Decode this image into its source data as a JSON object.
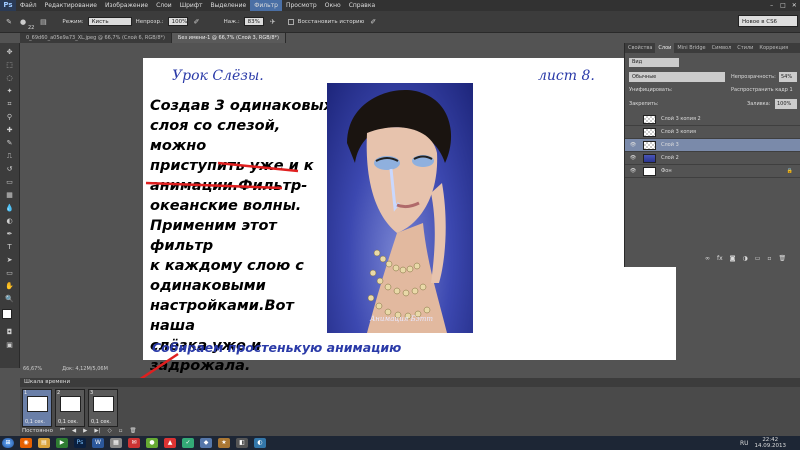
{
  "app": {
    "logo": "Ps"
  },
  "menu": [
    "Файл",
    "Редактирование",
    "Изображение",
    "Слои",
    "Шрифт",
    "Выделение",
    "Фильтр",
    "Просмотр",
    "Окно",
    "Справка"
  ],
  "options": {
    "brush_size": "22",
    "mode_label": "Режим:",
    "mode_value": "Кисть",
    "opacity_label": "Непрозр.:",
    "opacity_value": "100%",
    "flow_label": "Наж.:",
    "flow_value": "83%",
    "history_label": "Восстановить историю"
  },
  "workspace": "Новое в CS6",
  "doc_tabs": [
    "0_69d60_a05e9a73_XL.jpeg @ 66,7% (Слой 6, RGB/8*)",
    "Без имени-1 @ 66,7% (Слой 3, RGB/8*)"
  ],
  "canvas": {
    "title": "Урок Слёзы.",
    "sheet": "лист 8.",
    "body_lines": [
      "Создав 3 одинаковых",
      "слоя со слезой, можно",
      "приступить уже и к",
      "анимации.Фильтр-",
      "океанские волны.",
      "Применим этот фильтр",
      "к каждому слою с",
      "одинаковыми",
      "настройками.Вот наша",
      "слёзка уже и",
      "задрожала."
    ],
    "caption": "Собираем простенькую анимацию",
    "signature": "Анимация Бэтт"
  },
  "status": {
    "zoom": "66,67%",
    "doc": "Док: 4,12M/5,06M"
  },
  "timeline": {
    "title": "Шкала времени",
    "frames": [
      {
        "num": "1",
        "delay": "0,1 сек."
      },
      {
        "num": "2",
        "delay": "0,1 сек."
      },
      {
        "num": "3",
        "delay": "0,1 сек."
      }
    ],
    "loop": "Постоянно"
  },
  "panel": {
    "tabs": [
      "Свойства",
      "Слои",
      "Mini Bridge",
      "Символ",
      "Стили",
      "Коррекция"
    ],
    "search": "Вид",
    "blend": "Обычные",
    "opacity_label": "Непрозрачность:",
    "opacity_value": "54%",
    "unify_label": "Унифицировать:",
    "propagate_label": "Распространить кадр 1",
    "lock_label": "Закрепить:",
    "fill_label": "Заливка:",
    "fill_value": "100%",
    "layers": [
      {
        "name": "Слой 3 копия 2",
        "visible": false
      },
      {
        "name": "Слой 3 копия",
        "visible": false
      },
      {
        "name": "Слой 3",
        "visible": true,
        "selected": true
      },
      {
        "name": "Слой 2",
        "visible": true
      },
      {
        "name": "Фон",
        "visible": true
      }
    ]
  },
  "tray": {
    "lang": "RU",
    "time": "22:42",
    "date": "14.09.2013"
  },
  "colors": {
    "accent": "#4a6fa5",
    "text_blue": "#2a3aa8",
    "annot_red": "#e02020"
  }
}
